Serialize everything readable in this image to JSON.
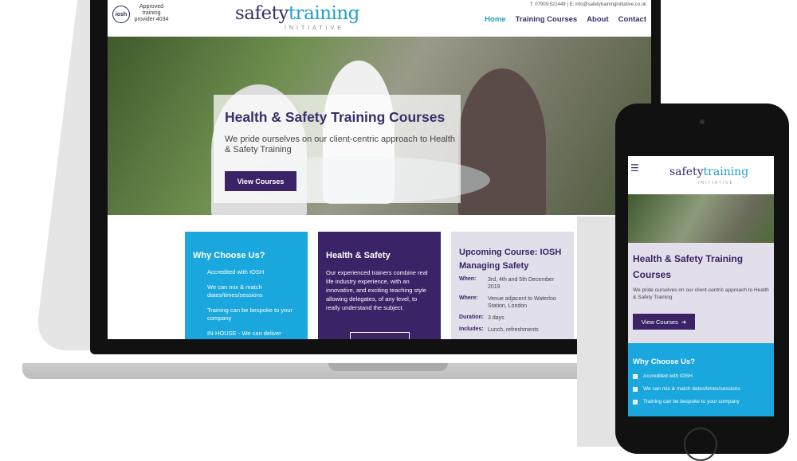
{
  "desktop": {
    "badge": {
      "logo_text": "iosh",
      "caption": "Approved training provider 4034"
    },
    "logo": {
      "word1": "safety",
      "word2": "training",
      "sub": "INITIATIVE"
    },
    "contact_line": "T: 07909 521449  |  E: info@safetytraininginitiative.co.uk",
    "nav": [
      "Home",
      "Training Courses",
      "About",
      "Contact"
    ],
    "hero": {
      "title": "Health & Safety Training Courses",
      "subtitle": "We pride ourselves on our client-centric approach to Health & Safety Training",
      "button": "View Courses"
    },
    "cards": {
      "why": {
        "title": "Why Choose Us?",
        "items": [
          "Accredited with IOSH",
          "We can mix & match dates/times/sessions",
          "Training can be bespoke to your company",
          "IN-HOUSE - We can deliver"
        ]
      },
      "hs": {
        "title": "Health & Safety",
        "text": "Our experienced trainers combine real life industry experience, with an innovative, and exciting teaching style allowing delegates, of any level, to really understand the subject."
      },
      "upcoming": {
        "title": "Upcoming Course: IOSH Managing Safety",
        "rows": [
          {
            "k": "When:",
            "v": "3rd, 4th and 5th December 2019"
          },
          {
            "k": "Where:",
            "v": "Venue adjacent to Waterloo Station, London"
          },
          {
            "k": "Duration:",
            "v": "3 days"
          },
          {
            "k": "Includes:",
            "v": "Lunch, refreshments"
          }
        ]
      }
    }
  },
  "mobile": {
    "logo": {
      "word1": "safety",
      "word2": "training",
      "sub": "INITIATIVE"
    },
    "title": "Health & Safety Training Courses",
    "subtitle": "We pride ourselves on our client-centric approach to Health & Safety Training",
    "button": "View Courses",
    "why_title": "Why Choose Us?",
    "why_items": [
      "Accredited with IOSH",
      "We can mix & match dates/times/sessions",
      "Training can be bespoke to your company"
    ]
  }
}
